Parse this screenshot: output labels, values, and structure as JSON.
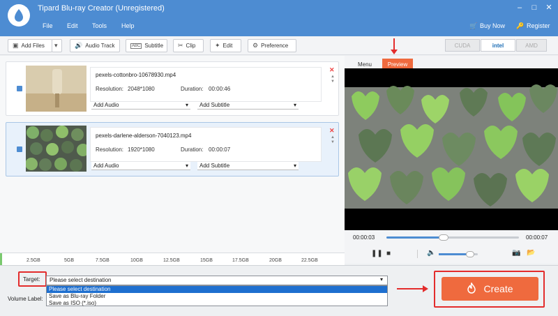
{
  "app": {
    "title": "Tipard Blu-ray Creator (Unregistered)",
    "menu": [
      "File",
      "Edit",
      "Tools",
      "Help"
    ],
    "buy_now": "Buy Now",
    "register": "Register"
  },
  "toolbar": {
    "add_files": "Add Files",
    "audio_track": "Audio Track",
    "subtitle": "Subtitle",
    "clip": "Clip",
    "edit": "Edit",
    "preference": "Preference",
    "hw": [
      "CUDA",
      "intel",
      "AMD"
    ]
  },
  "files": [
    {
      "name": "pexels-cottonbro-10678930.mp4",
      "resolution_label": "Resolution:",
      "resolution": "2048*1080",
      "duration_label": "Duration:",
      "duration": "00:00:46",
      "add_audio": "Add Audio",
      "add_subtitle": "Add Subtitle"
    },
    {
      "name": "pexels-darlene-alderson-7040123.mp4",
      "resolution_label": "Resolution:",
      "resolution": "1920*1080",
      "duration_label": "Duration:",
      "duration": "00:00:07",
      "add_audio": "Add Audio",
      "add_subtitle": "Add Subtitle"
    }
  ],
  "preview": {
    "tabs": [
      "Menu",
      "Preview"
    ],
    "time_current": "00:00:03",
    "time_total": "00:00:07",
    "progress": 0.43,
    "volume": 0.8
  },
  "sizes": [
    "2.5GB",
    "5GB",
    "7.5GB",
    "10GB",
    "12.5GB",
    "15GB",
    "17.5GB",
    "20GB",
    "22.5GB"
  ],
  "bottom": {
    "target_label": "Target:",
    "volume_label": "Volume Label:",
    "dest_value": "Please select destination",
    "options": [
      "Please select destination",
      "Save as Blu-ray Folder",
      "Save as ISO (*.iso)"
    ],
    "create": "Create"
  },
  "colors": {
    "titlebar": "#4d8cd2",
    "accent": "#ef6a3e",
    "highlight": "#e32c2c"
  }
}
